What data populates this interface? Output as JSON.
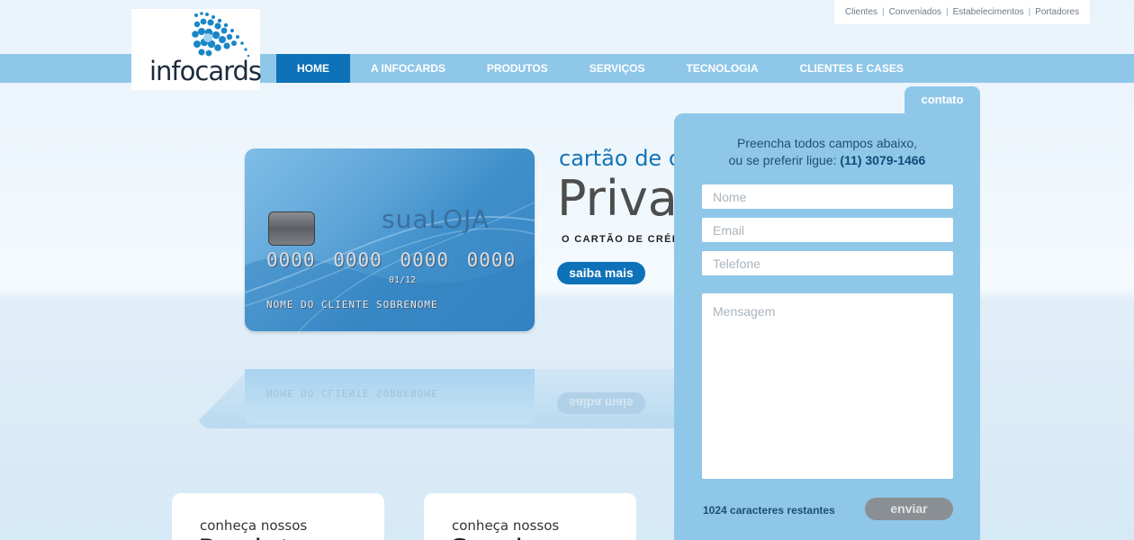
{
  "top_links": [
    "Clientes",
    "Conveniados",
    "Estabelecimentos",
    "Portadores"
  ],
  "logo": {
    "text": "infocards"
  },
  "nav": [
    {
      "label": "HOME",
      "active": true
    },
    {
      "label": "A INFOCARDS"
    },
    {
      "label": "PRODUTOS"
    },
    {
      "label": "SERVIÇOS"
    },
    {
      "label": "TECNOLOGIA"
    },
    {
      "label": "CLIENTES E CASES"
    }
  ],
  "card": {
    "brand": "suaLOJA",
    "number": "0000 0000 0000 0000",
    "expiry": "01/12",
    "holder": "NOME DO CLIENTE SOBRENOME"
  },
  "hero": {
    "subtitle": "cartão de c",
    "title": "Priva",
    "caption": "O CARTÃO DE CRÉDIT",
    "button": "saiba mais"
  },
  "features": [
    {
      "pre": "conheça nossos",
      "big": "Produtos"
    },
    {
      "pre": "conheça nossos",
      "big": "Serviços"
    }
  ],
  "contact": {
    "tab": "contato",
    "intro_line1": "Preencha todos campos abaixo,",
    "intro_line2": "ou se preferir ligue:",
    "phone": "(11) 3079-1466",
    "placeholders": {
      "name": "Nome",
      "email": "Email",
      "phone": "Telefone",
      "message": "Mensagem"
    },
    "remaining": "1024 caracteres restantes",
    "send": "enviar"
  },
  "colors": {
    "accent": "#0e72b8",
    "nav_bg": "#8fc7e9",
    "button_gray": "#8a8f93"
  }
}
